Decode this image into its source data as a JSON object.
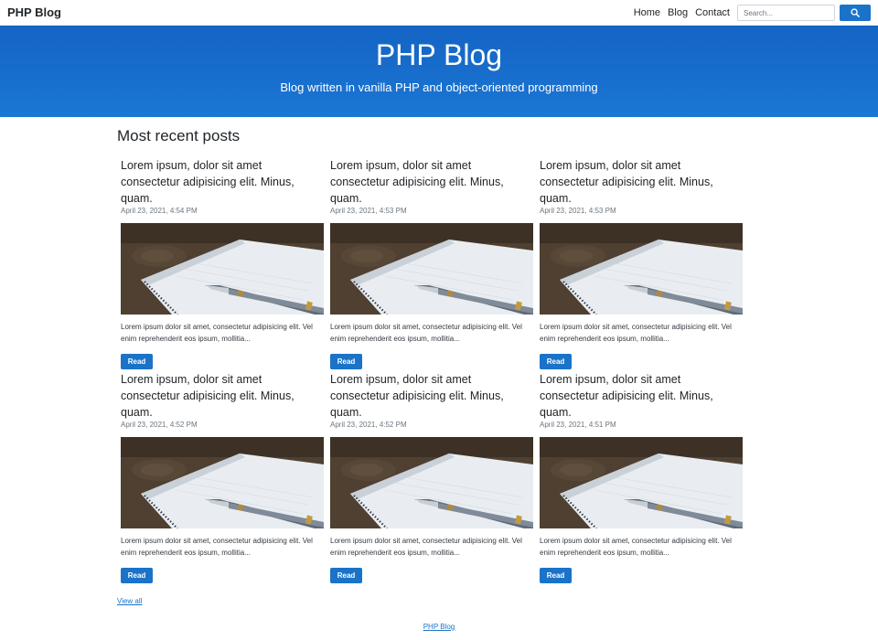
{
  "nav": {
    "brand": "PHP Blog",
    "links": [
      "Home",
      "Blog",
      "Contact"
    ],
    "search_placeholder": "Search...",
    "search_icon": "search-icon"
  },
  "hero": {
    "title": "PHP Blog",
    "subtitle": "Blog written in vanilla PHP and object-oriented programming"
  },
  "main": {
    "section_title": "Most recent posts",
    "posts": [
      {
        "title": "Lorem ipsum, dolor sit amet consectetur adipisicing elit. Minus, quam.",
        "date": "April 23, 2021, 4:54 PM",
        "excerpt": "Lorem ipsum dolor sit amet, consectetur adipisicing elit. Vel enim reprehenderit eos ipsum, mollitia...",
        "button": "Read"
      },
      {
        "title": "Lorem ipsum, dolor sit amet consectetur adipisicing elit. Minus, quam.",
        "date": "April 23, 2021, 4:53 PM",
        "excerpt": "Lorem ipsum dolor sit amet, consectetur adipisicing elit. Vel enim reprehenderit eos ipsum, mollitia...",
        "button": "Read"
      },
      {
        "title": "Lorem ipsum, dolor sit amet consectetur adipisicing elit. Minus, quam.",
        "date": "April 23, 2021, 4:53 PM",
        "excerpt": "Lorem ipsum dolor sit amet, consectetur adipisicing elit. Vel enim reprehenderit eos ipsum, mollitia...",
        "button": "Read"
      },
      {
        "title": "Lorem ipsum, dolor sit amet consectetur adipisicing elit. Minus, quam.",
        "date": "April 23, 2021, 4:52 PM",
        "excerpt": "Lorem ipsum dolor sit amet, consectetur adipisicing elit. Vel enim reprehenderit eos ipsum, mollitia...",
        "button": "Read"
      },
      {
        "title": "Lorem ipsum, dolor sit amet consectetur adipisicing elit. Minus, quam.",
        "date": "April 23, 2021, 4:52 PM",
        "excerpt": "Lorem ipsum dolor sit amet, consectetur adipisicing elit. Vel enim reprehenderit eos ipsum, mollitia...",
        "button": "Read"
      },
      {
        "title": "Lorem ipsum, dolor sit amet consectetur adipisicing elit. Minus, quam.",
        "date": "April 23, 2021, 4:51 PM",
        "excerpt": "Lorem ipsum dolor sit amet, consectetur adipisicing elit. Vel enim reprehenderit eos ipsum, mollitia...",
        "button": "Read"
      }
    ],
    "view_all": "View all"
  },
  "footer": {
    "link": "PHP Blog"
  },
  "colors": {
    "primary": "#1a73c9",
    "hero_start": "#1464c4",
    "hero_end": "#1b76d4"
  }
}
